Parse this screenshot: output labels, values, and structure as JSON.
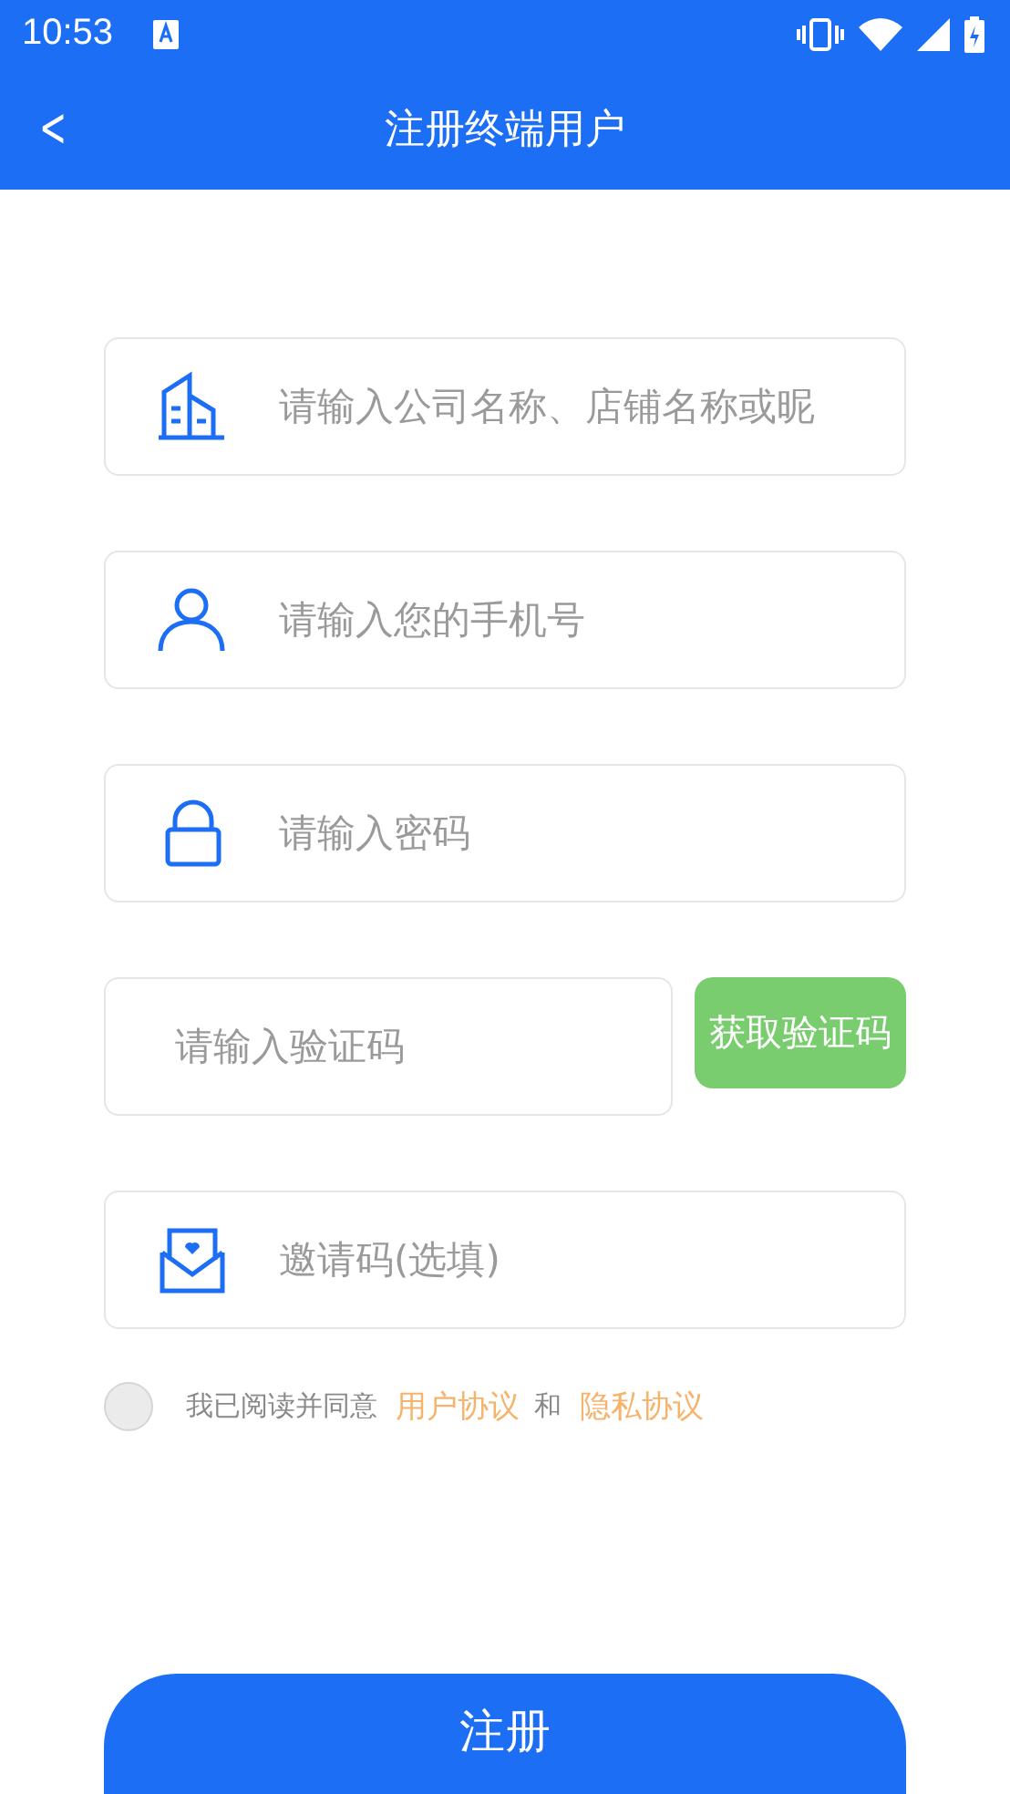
{
  "status_bar": {
    "time": "10:53"
  },
  "app_bar": {
    "back": "<",
    "title": "注册终端用户"
  },
  "fields": [
    {
      "kind": "company",
      "placeholder": "请输入公司名称、店铺名称或昵"
    },
    {
      "kind": "phone",
      "placeholder": "请输入您的手机号"
    },
    {
      "kind": "password",
      "placeholder": "请输入密码"
    },
    {
      "kind": "code",
      "placeholder": "请输入验证码",
      "button": "获取验证码"
    },
    {
      "kind": "invite",
      "placeholder": "邀请码(选填)"
    }
  ],
  "agreement": {
    "checked": false,
    "text": "我已阅读并同意",
    "link_1": "用户协议",
    "conjunction": "和",
    "link_2": "隐私协议"
  },
  "submit": "注册"
}
